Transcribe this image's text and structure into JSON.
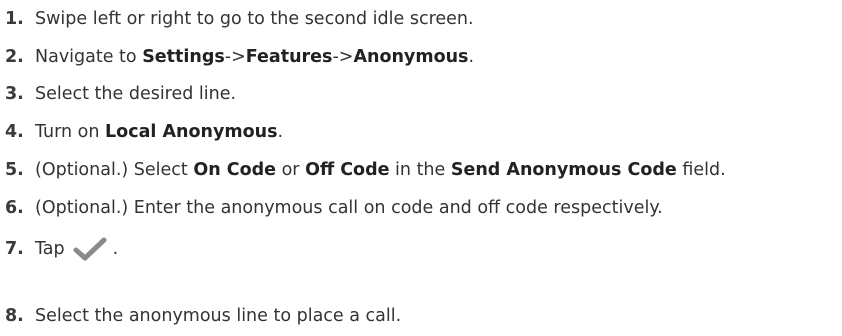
{
  "steps": [
    {
      "num": "1.",
      "parts": [
        "Swipe left or right to go to the second idle screen."
      ]
    },
    {
      "num": "2.",
      "parts": [
        "Navigate to ",
        "Settings",
        "->",
        "Features",
        "->",
        "Anonymous",
        "."
      ]
    },
    {
      "num": "3.",
      "parts": [
        "Select the desired line."
      ]
    },
    {
      "num": "4.",
      "parts": [
        "Turn on ",
        "Local Anonymous",
        "."
      ]
    },
    {
      "num": "5.",
      "parts": [
        "(Optional.) Select ",
        "On Code",
        " or ",
        "Off Code",
        " in the ",
        "Send Anonymous Code",
        " field."
      ]
    },
    {
      "num": "6.",
      "parts": [
        "(Optional.) Enter the anonymous call on code and off code respectively."
      ]
    },
    {
      "num": "7.",
      "parts": [
        "Tap",
        "."
      ],
      "icon": "checkmark-icon",
      "icon_color": "#8a8a8a"
    },
    {
      "num": "8.",
      "parts": [
        "Select the anonymous line to place a call."
      ]
    }
  ]
}
